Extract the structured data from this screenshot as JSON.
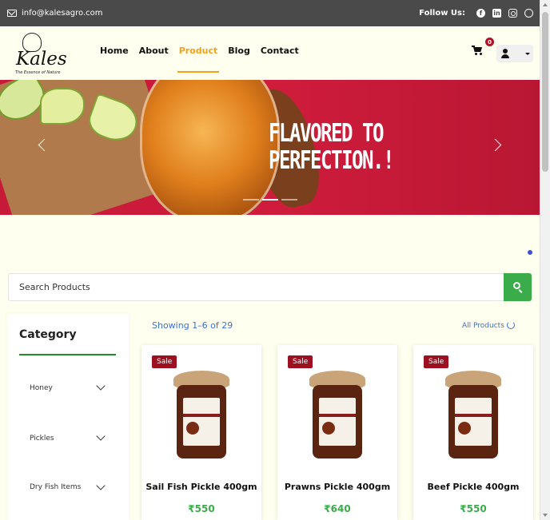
{
  "topbar": {
    "email": "info@kalesagro.com",
    "follow_label": "Follow Us:",
    "socials": [
      "facebook-icon",
      "linkedin-icon",
      "instagram-icon",
      "whatsapp-icon"
    ]
  },
  "header": {
    "logo_text": "Kales",
    "logo_tagline": "The Essence of Nature",
    "nav": [
      {
        "label": "Home",
        "active": false
      },
      {
        "label": "About",
        "active": false
      },
      {
        "label": "Product",
        "active": true
      },
      {
        "label": "Blog",
        "active": false
      },
      {
        "label": "Contact",
        "active": false
      }
    ],
    "cart_count": "0"
  },
  "hero": {
    "headline_line1": "FLAVORED TO",
    "headline_line2": "PERFECTION.!",
    "slides": 3,
    "active_slide": 2
  },
  "search": {
    "placeholder": "Search Products"
  },
  "sidebar": {
    "title": "Category",
    "items": [
      {
        "label": "Honey"
      },
      {
        "label": "Pickles"
      },
      {
        "label": "Dry Fish Items"
      }
    ]
  },
  "listing": {
    "showing": "Showing 1–6 of 29",
    "all_products": "All Products"
  },
  "products": [
    {
      "badge": "Sale",
      "name": "Sail Fish Pickle 400gm",
      "price": "₹550"
    },
    {
      "badge": "Sale",
      "name": "Prawns Pickle 400gm",
      "price": "₹640"
    },
    {
      "badge": "Sale",
      "name": "Beef Pickle 400gm",
      "price": "₹550"
    }
  ],
  "colors": {
    "accent": "#f5a21b",
    "topbar": "#4a4a4a",
    "hero": "#c71a38",
    "sale": "#9d1020",
    "price": "#3aac49",
    "link": "#3b6fd8"
  }
}
